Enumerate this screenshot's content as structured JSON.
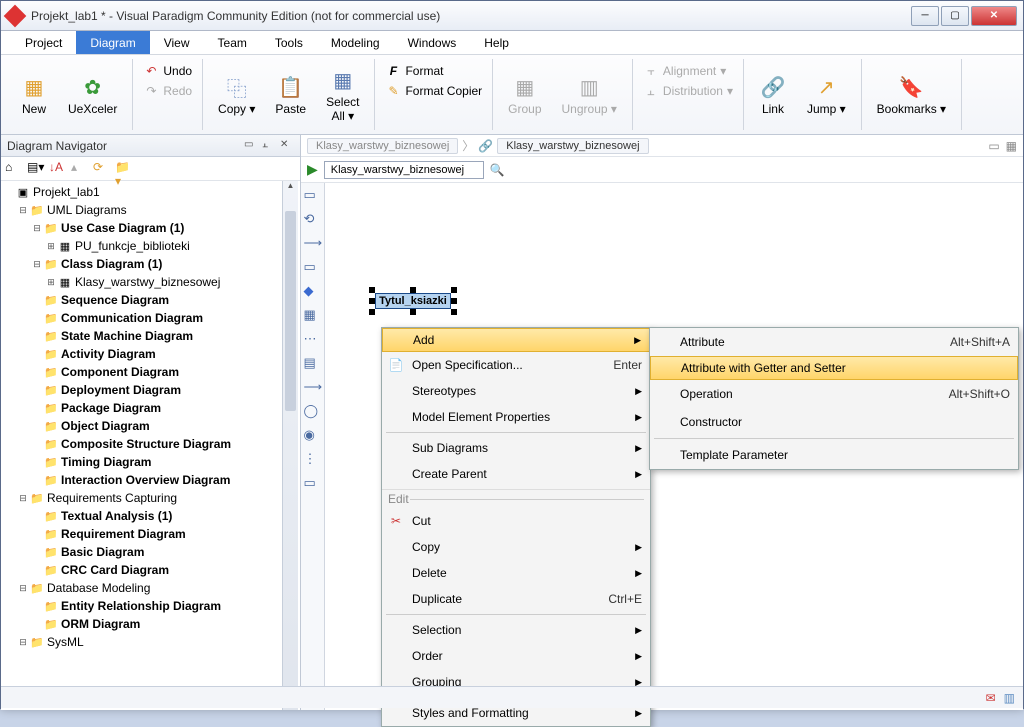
{
  "window": {
    "title": "Projekt_lab1 * - Visual Paradigm Community Edition (not for commercial use)"
  },
  "menubar": [
    "Project",
    "Diagram",
    "View",
    "Team",
    "Tools",
    "Modeling",
    "Windows",
    "Help"
  ],
  "ribbon": {
    "new": "New",
    "uexceler": "UeXceler",
    "undo": "Undo",
    "redo": "Redo",
    "copy": "Copy",
    "paste": "Paste",
    "selectall": "Select\nAll",
    "format": "Format",
    "formatcopier": "Format Copier",
    "group": "Group",
    "ungroup": "Ungroup",
    "alignment": "Alignment",
    "distribution": "Distribution",
    "link": "Link",
    "jump": "Jump",
    "bookmarks": "Bookmarks"
  },
  "navigator": {
    "title": "Diagram Navigator",
    "root": "Projekt_lab1",
    "nodes": {
      "uml": "UML Diagrams",
      "usecase": "Use Case Diagram (1)",
      "pu": "PU_funkcje_biblioteki",
      "classd": "Class Diagram (1)",
      "klasy": "Klasy_warstwy_biznesowej",
      "sequence": "Sequence Diagram",
      "communication": "Communication Diagram",
      "statemachine": "State Machine Diagram",
      "activity": "Activity Diagram",
      "component": "Component Diagram",
      "deployment": "Deployment Diagram",
      "package": "Package Diagram",
      "object": "Object Diagram",
      "composite": "Composite Structure Diagram",
      "timing": "Timing Diagram",
      "interaction": "Interaction Overview Diagram",
      "req": "Requirements Capturing",
      "textual": "Textual Analysis (1)",
      "reqd": "Requirement Diagram",
      "basic": "Basic Diagram",
      "crc": "CRC Card Diagram",
      "db": "Database Modeling",
      "erd": "Entity Relationship Diagram",
      "orm": "ORM Diagram",
      "sysml": "SysML"
    }
  },
  "breadcrumb": {
    "a": "Klasy_warstwy_biznesowej",
    "b": "Klasy_warstwy_biznesowej"
  },
  "tab_input": "Klasy_warstwy_biznesowej",
  "uml_class_name": "Tytul_ksiazki",
  "contextmenu": {
    "add": "Add",
    "openspec": "Open Specification...",
    "openspec_key": "Enter",
    "stereotypes": "Stereotypes",
    "modelprops": "Model Element Properties",
    "subdiagrams": "Sub Diagrams",
    "createparent": "Create Parent",
    "edit_section": "Edit",
    "cut": "Cut",
    "copy": "Copy",
    "delete": "Delete",
    "duplicate": "Duplicate",
    "duplicate_key": "Ctrl+E",
    "selection": "Selection",
    "order": "Order",
    "grouping": "Grouping",
    "styles": "Styles and Formatting"
  },
  "submenu": {
    "attribute": "Attribute",
    "attribute_key": "Alt+Shift+A",
    "attrgs": "Attribute with Getter and Setter",
    "operation": "Operation",
    "operation_key": "Alt+Shift+O",
    "constructor": "Constructor",
    "template": "Template Parameter"
  }
}
